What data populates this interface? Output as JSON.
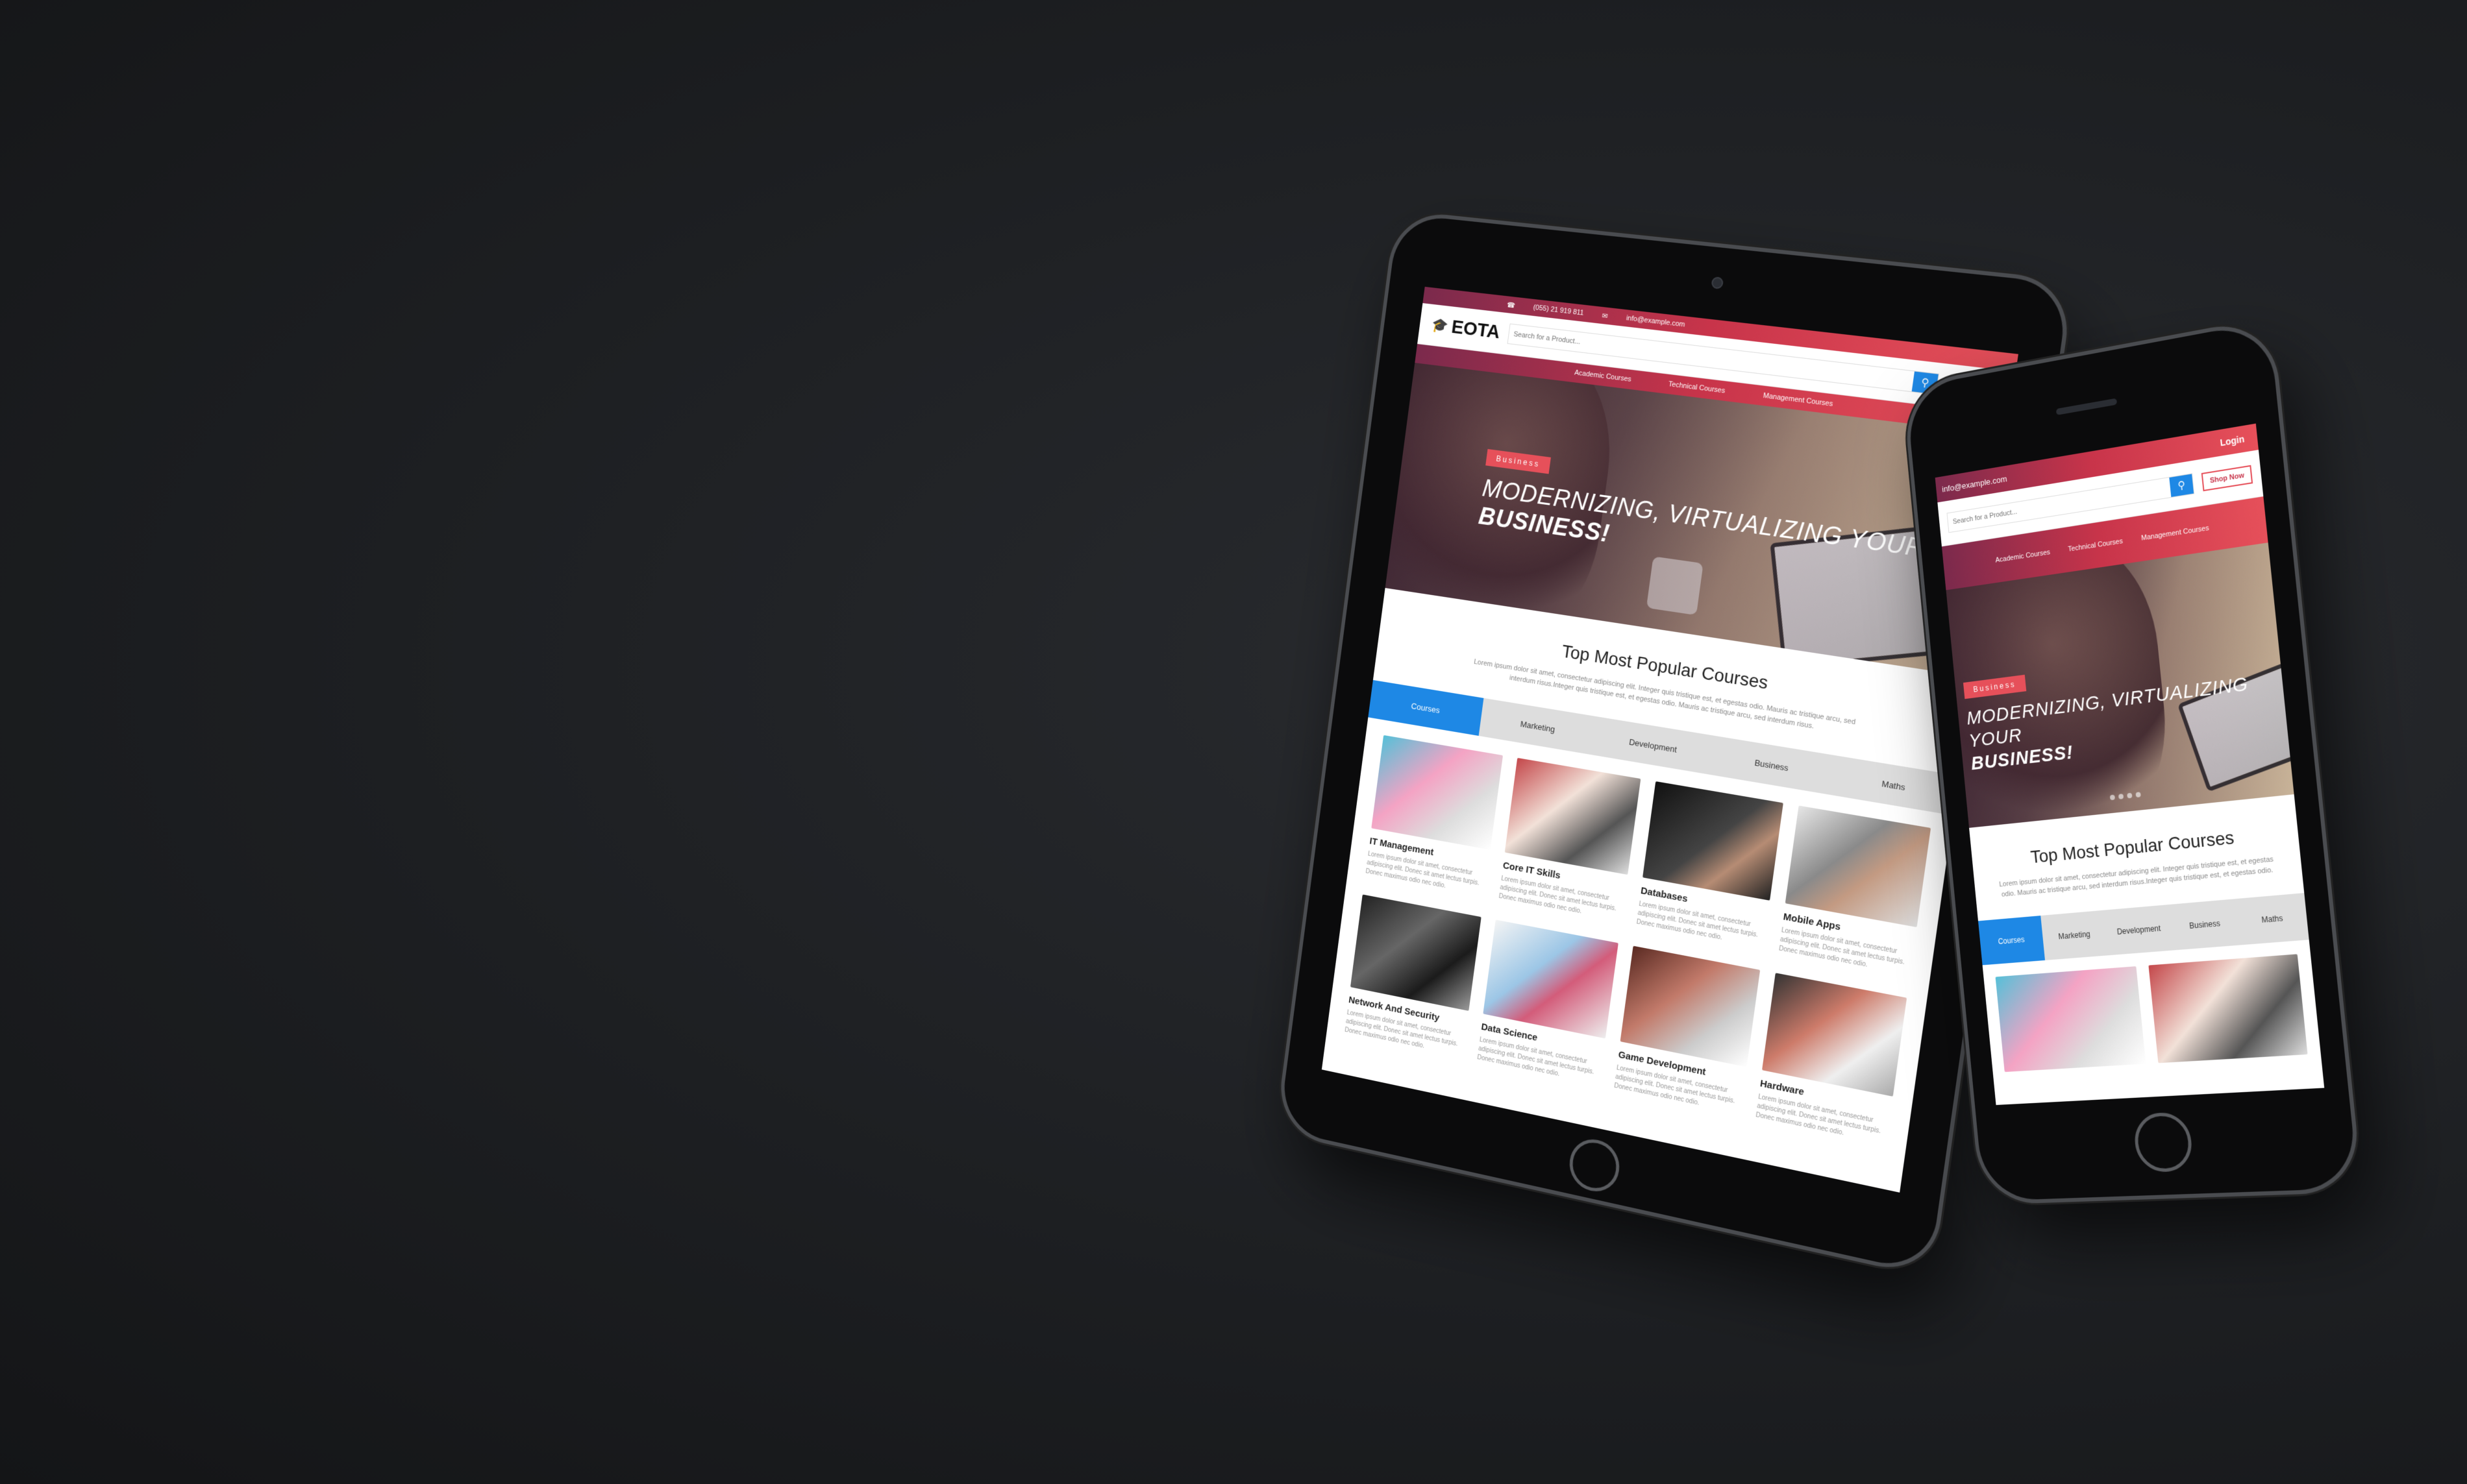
{
  "site": {
    "phone": "(055) 21 919 811",
    "email": "info@example.com",
    "logo": "EOTA",
    "search_placeholder": "Search for a Product...",
    "login": "Login",
    "shop_now": "Shop Now",
    "nav": [
      "Academic Courses",
      "Technical Courses",
      "Management Courses"
    ],
    "hero": {
      "tag": "Business",
      "title_line1": "MODERNIZING, VIRTUALIZING YOUR",
      "title_line2": "BUSINESS!"
    },
    "section": {
      "title": "Top Most Popular Courses",
      "text": "Lorem ipsum dolor sit amet, consectetur adipiscing elit. Integer quis tristique est, et egestas odio. Mauris ac tristique arcu, sed interdum risus.Integer quis tristique est, et egestas odio. Mauris ac tristique arcu, sed interdum risus."
    },
    "tabs": [
      "Courses",
      "Marketing",
      "Development",
      "Business",
      "Maths"
    ],
    "courses": [
      {
        "title": "IT Management",
        "desc": "Lorem ipsum dolor sit amet, consectetur adipiscing elit. Donec sit amet lectus turpis. Donec maximus odio nec odio."
      },
      {
        "title": "Core IT Skills",
        "desc": "Lorem ipsum dolor sit amet, consectetur adipiscing elit. Donec sit amet lectus turpis. Donec maximus odio nec odio."
      },
      {
        "title": "Databases",
        "desc": "Lorem ipsum dolor sit amet, consectetur adipiscing elit. Donec sit amet lectus turpis. Donec maximus odio nec odio."
      },
      {
        "title": "Mobile Apps",
        "desc": "Lorem ipsum dolor sit amet, consectetur adipiscing elit. Donec sit amet lectus turpis. Donec maximus odio nec odio."
      },
      {
        "title": "Network And Security",
        "desc": "Lorem ipsum dolor sit amet, consectetur adipiscing elit. Donec sit amet lectus turpis. Donec maximus odio nec odio."
      },
      {
        "title": "Data Science",
        "desc": "Lorem ipsum dolor sit amet, consectetur adipiscing elit. Donec sit amet lectus turpis. Donec maximus odio nec odio."
      },
      {
        "title": "Game Development",
        "desc": "Lorem ipsum dolor sit amet, consectetur adipiscing elit. Donec sit amet lectus turpis. Donec maximus odio nec odio."
      },
      {
        "title": "Hardware",
        "desc": "Lorem ipsum dolor sit amet, consectetur adipiscing elit. Donec sit amet lectus turpis. Donec maximus odio nec odio."
      }
    ]
  },
  "phone_site": {
    "email": "info@example.com",
    "tabs": [
      "Courses",
      "Marketing",
      "Development",
      "Business",
      "Maths"
    ],
    "section_text": "Lorem ipsum dolor sit amet, consectetur adipiscing elit. Integer quis tristique est, et egestas odio. Mauris ac tristique arcu, sed interdum risus.Integer quis tristique est, et egestas odio."
  },
  "colors": {
    "accent_gradient_start": "#7b2a4c",
    "accent_gradient_end": "#e6505a",
    "active_tab": "#1e88e5",
    "background": "#1d1f22"
  },
  "icons": [
    "search-icon",
    "graduation-cap-icon",
    "phone-icon",
    "mail-icon"
  ]
}
